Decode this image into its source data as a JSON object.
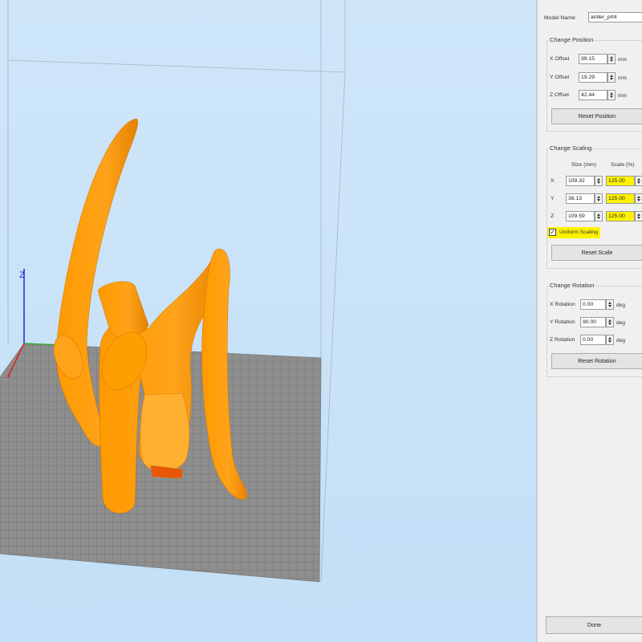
{
  "panel": {
    "model_name_label": "Model Name:",
    "model_name_value": "antler_prt4",
    "position": {
      "title": "Change Position",
      "x_label": "X Offset",
      "x_value": "99.15",
      "y_label": "Y Offset",
      "y_value": "19.29",
      "z_label": "Z Offset",
      "z_value": "42.44",
      "unit": "mm",
      "reset_label": "Reset Position"
    },
    "scaling": {
      "title": "Change Scaling",
      "size_header": "Size (mm)",
      "scale_header": "Scale (%)",
      "rows": [
        {
          "axis": "X",
          "size": "109.32",
          "scale": "125.00"
        },
        {
          "axis": "Y",
          "size": "38.13",
          "scale": "125.00"
        },
        {
          "axis": "Z",
          "size": "109.59",
          "scale": "125.00"
        }
      ],
      "uniform_label": "Uniform Scaling",
      "uniform_checked": true,
      "reset_label": "Reset Scale"
    },
    "rotation": {
      "title": "Change Rotation",
      "x_label": "X Rotation",
      "x_value": "0.00",
      "y_label": "Y Rotation",
      "y_value": "90.00",
      "z_label": "Z Rotation",
      "z_value": "0.00",
      "unit": "deg",
      "reset_label": "Reset Rotation"
    },
    "done_label": "Done"
  },
  "colors": {
    "model": "#ff9e00",
    "highlight": "#fff200",
    "bed": "#8e8e8e"
  }
}
